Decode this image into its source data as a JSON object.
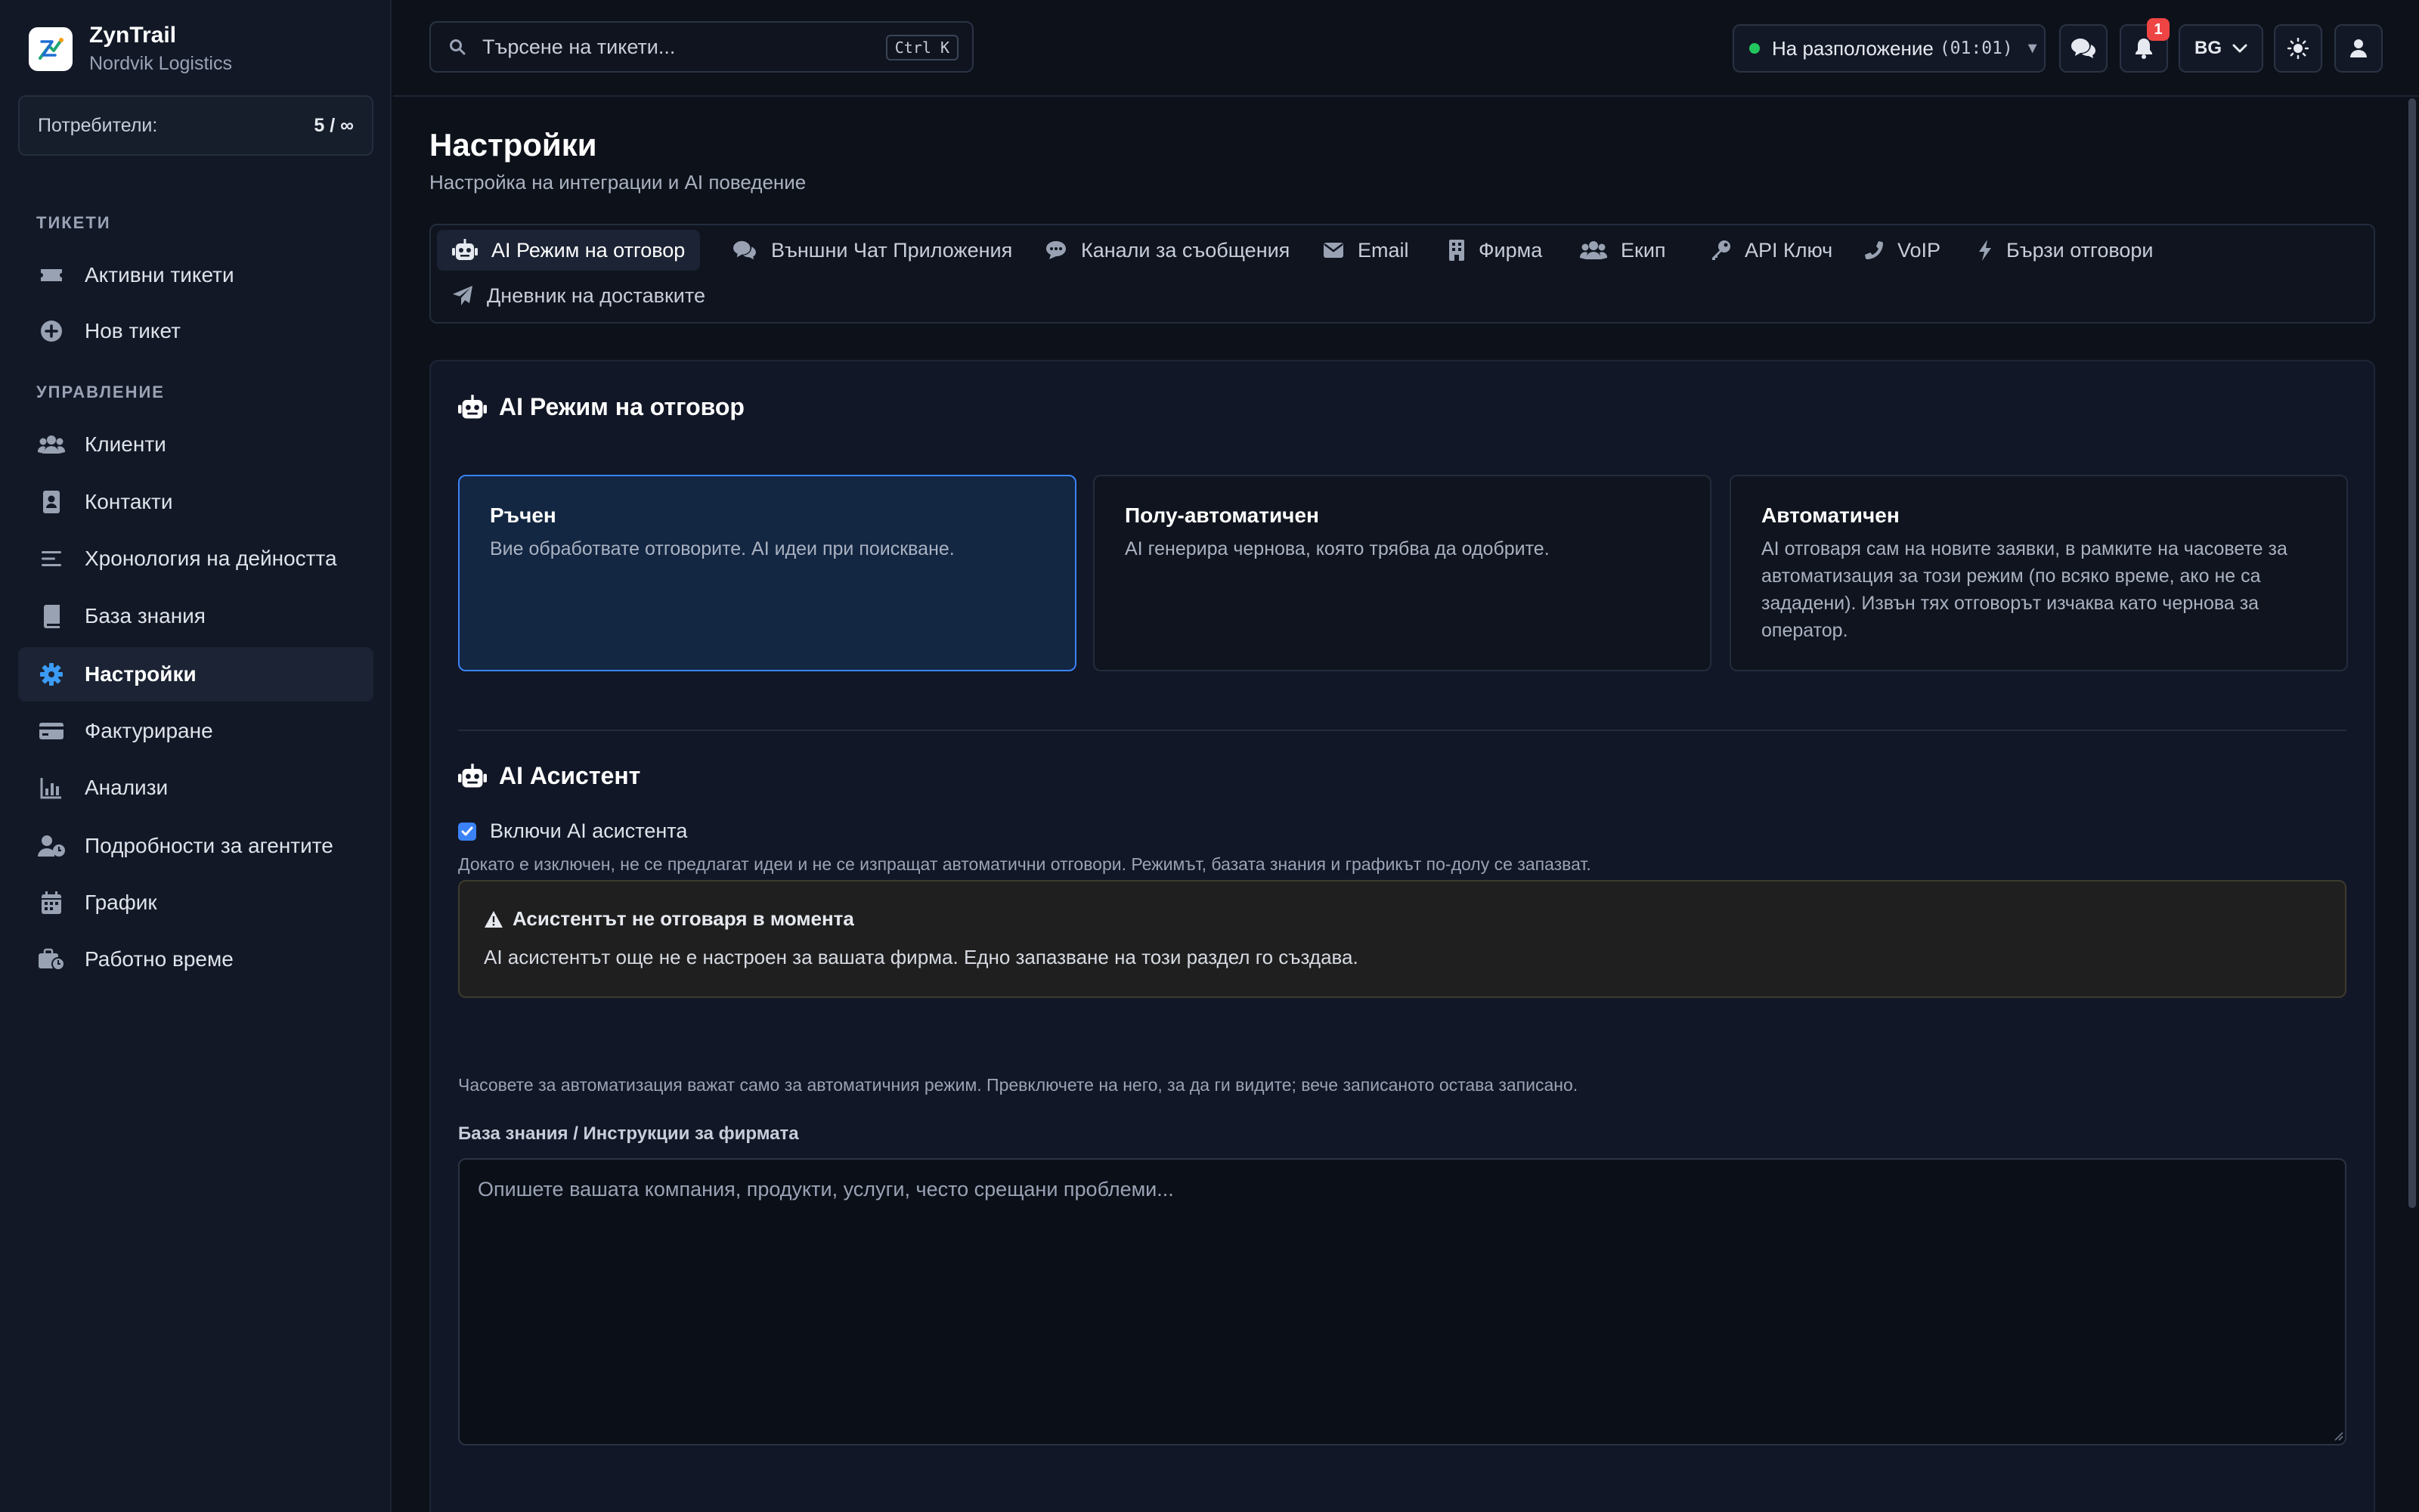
{
  "brand": {
    "name": "ZynTrail",
    "company": "Nordvik Logistics"
  },
  "users": {
    "label": "Потребители:",
    "count": "5 / ∞"
  },
  "sidebar": {
    "sections": [
      {
        "title": "ТИКЕТИ",
        "items": [
          {
            "label": "Активни тикети",
            "icon": "ticket-icon"
          },
          {
            "label": "Нов тикет",
            "icon": "plus-circle-icon"
          }
        ]
      },
      {
        "title": "УПРАВЛЕНИЕ",
        "items": [
          {
            "label": "Клиенти",
            "icon": "users-icon"
          },
          {
            "label": "Контакти",
            "icon": "address-book-icon"
          },
          {
            "label": "Хронология на дейността",
            "icon": "list-icon"
          },
          {
            "label": "База знания",
            "icon": "book-icon"
          },
          {
            "label": "Настройки",
            "icon": "gear-icon",
            "active": true
          },
          {
            "label": "Фактуриране",
            "icon": "credit-card-icon"
          },
          {
            "label": "Анализи",
            "icon": "chart-icon"
          },
          {
            "label": "Подробности за агентите",
            "icon": "user-clock-icon"
          },
          {
            "label": "График",
            "icon": "calendar-icon"
          },
          {
            "label": "Работно време",
            "icon": "briefcase-clock-icon"
          }
        ]
      }
    ]
  },
  "topbar": {
    "search_placeholder": "Търсене на тикети...",
    "search_shortcut": "Ctrl K",
    "status_label": "На разположение",
    "status_time": "(01:01)",
    "status_color": "#22c55e",
    "notifications_count": "1",
    "language": "BG"
  },
  "page": {
    "title": "Настройки",
    "subtitle": "Настройка на интеграции и AI поведение"
  },
  "tabs": [
    {
      "label": "AI Режим на отговор",
      "icon": "robot-icon",
      "active": true
    },
    {
      "label": "Външни Чат Приложения",
      "icon": "comments-icon"
    },
    {
      "label": "Канали за съобщения",
      "icon": "comment-dots-icon"
    },
    {
      "label": "Email",
      "icon": "envelope-icon"
    },
    {
      "label": "Фирма",
      "icon": "building-icon"
    },
    {
      "label": "Екип",
      "icon": "team-icon"
    },
    {
      "label": "API Ключ",
      "icon": "key-icon"
    },
    {
      "label": "VoIP",
      "icon": "phone-icon"
    },
    {
      "label": "Бързи отговори",
      "icon": "bolt-icon"
    },
    {
      "label": "Дневник на доставките",
      "icon": "paper-plane-icon"
    }
  ],
  "ai_mode": {
    "heading": "AI Режим на отговор",
    "options": [
      {
        "title": "Ръчен",
        "desc": "Вие обработвате отговорите. AI идеи при поискване.",
        "selected": true
      },
      {
        "title": "Полу-автоматичен",
        "desc": "AI генерира чернова, която трябва да одобрите."
      },
      {
        "title": "Автоматичен",
        "desc": "AI отговаря сам на новите заявки, в рамките на часовете за автоматизация за този режим (по всяко време, ако не са зададени). Извън тях отговорът изчаква като чернова за оператор."
      }
    ]
  },
  "assistant": {
    "heading": "AI Асистент",
    "toggle_label": "Включи AI асистента",
    "toggle_checked": true,
    "toggle_hint": "Докато е изключен, не се предлагат идеи и не се изпращат автоматични отговори. Режимът, базата знания и графикът по-долу се запазват.",
    "warning_title": "Асистентът не отговаря в момента",
    "warning_text": "AI асистентът още не е настроен за вашата фирма. Едно запазване на този раздел го създава.",
    "automation_hint": "Часовете за автоматизация важат само за автоматичния режим. Превключете на него, за да ги видите; вече записаното остава записано.",
    "kb_label": "База знания / Инструкции за фирмата",
    "kb_value": "",
    "kb_placeholder": "Опишете вашата компания, продукти, услуги, често срещани проблеми..."
  },
  "colors": {
    "accent": "#3b82f6",
    "active_icon": "#3b9bf5",
    "badge": "#ef4444",
    "warning_icon": "#e6e9ef"
  }
}
